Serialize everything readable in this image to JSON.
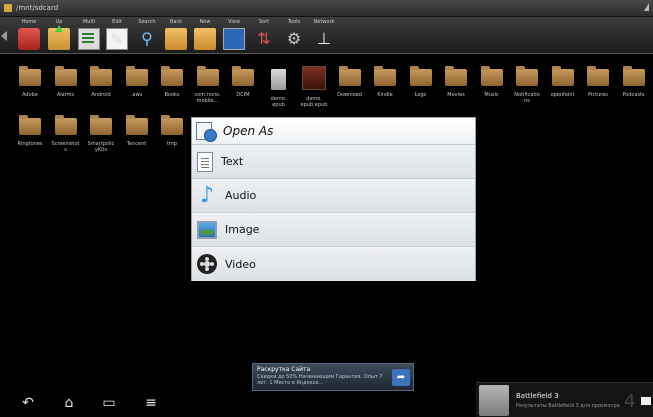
{
  "window": {
    "title": "/mnt/sdcard"
  },
  "toolbar": {
    "buttons": [
      {
        "label": "Home",
        "icon": "home-icon"
      },
      {
        "label": "Up",
        "icon": "up-icon"
      },
      {
        "label": "Multi",
        "icon": "multi-select-icon"
      },
      {
        "label": "Edit",
        "icon": "edit-icon"
      },
      {
        "label": "Search",
        "icon": "search-icon"
      },
      {
        "label": "Back",
        "icon": "back-folder-icon"
      },
      {
        "label": "New",
        "icon": "new-folder-icon"
      },
      {
        "label": "View",
        "icon": "view-icon"
      },
      {
        "label": "Sort",
        "icon": "sort-icon"
      },
      {
        "label": "Tools",
        "icon": "tools-icon"
      },
      {
        "label": "Network",
        "icon": "network-icon"
      }
    ]
  },
  "files": {
    "row1": [
      {
        "label": "Adobe",
        "type": "folder"
      },
      {
        "label": "Alarms",
        "type": "folder"
      },
      {
        "label": "Android",
        "type": "folder"
      },
      {
        "label": ".aws",
        "type": "folder"
      },
      {
        "label": "Books",
        "type": "folder"
      },
      {
        "label": "com.rovio.\nmobile...",
        "type": "folder"
      },
      {
        "label": "DCIM",
        "type": "folder"
      },
      {
        "label": "demo.\nepub",
        "type": "file"
      },
      {
        "label": "demo.\nepub.epub",
        "type": "book"
      },
      {
        "label": "Download",
        "type": "folder"
      },
      {
        "label": "Kindle",
        "type": "folder"
      },
      {
        "label": "Logs",
        "type": "folder"
      },
      {
        "label": "Movies",
        "type": "folder"
      },
      {
        "label": "Music",
        "type": "folder"
      },
      {
        "label": "Notificatio\nns",
        "type": "folder"
      },
      {
        "label": "openfeint",
        "type": "folder"
      },
      {
        "label": "Pictures",
        "type": "folder"
      },
      {
        "label": "Podcasts",
        "type": "folder"
      }
    ],
    "row2": [
      {
        "label": "Ringtones",
        "type": "folder"
      },
      {
        "label": "Screenshot\ns",
        "type": "folder"
      },
      {
        "label": "Smartpolic\nyKits",
        "type": "folder"
      },
      {
        "label": "Tencent",
        "type": "folder"
      },
      {
        "label": "tmp",
        "type": "folder"
      }
    ]
  },
  "dialog": {
    "title": "Open As",
    "options": [
      {
        "label": "Text",
        "icon": "text-file-icon"
      },
      {
        "label": "Audio",
        "icon": "music-note-icon"
      },
      {
        "label": "Image",
        "icon": "image-icon"
      },
      {
        "label": "Video",
        "icon": "film-reel-icon"
      }
    ]
  },
  "ad": {
    "title": "Раскрутка Сайта",
    "text": "Скидки до 50% Начинающим Гарантия. Опыт 7 лет. 1 Место в Яндексе..."
  },
  "notification": {
    "title": "Battlefield 3",
    "text": "Результаты Battlefield 3 для просмотра",
    "count": "4"
  },
  "nav": {
    "back": "↶",
    "home": "⌂",
    "recent": "▭",
    "menu": "≡"
  }
}
